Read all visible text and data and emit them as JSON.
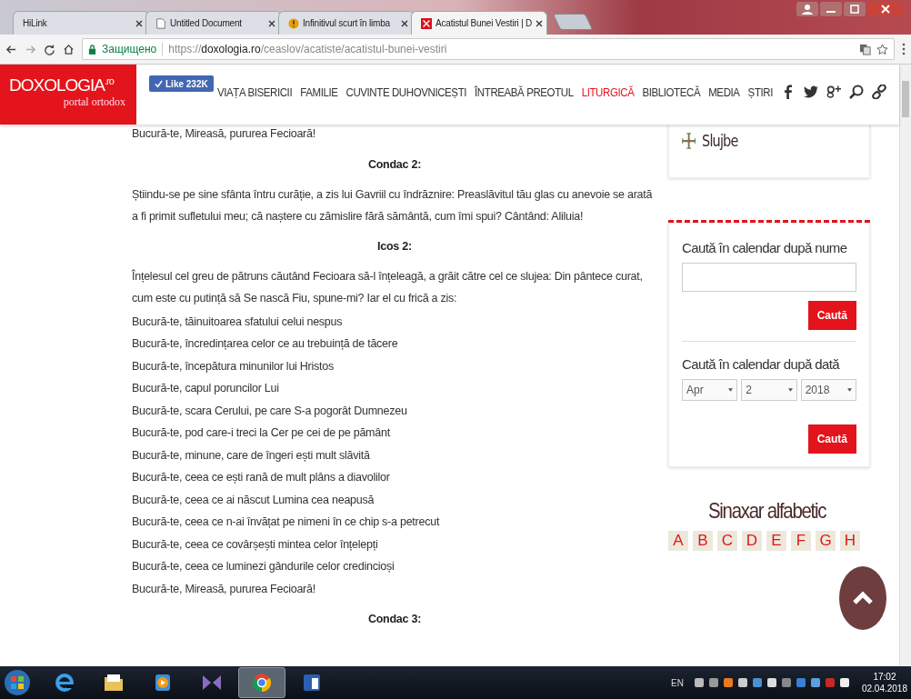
{
  "browser": {
    "tabs": [
      {
        "title": "HiLink",
        "selected": false
      },
      {
        "title": "Untitled Document",
        "selected": false
      },
      {
        "title": "Infinitivul scurt în limba",
        "selected": false
      },
      {
        "title": "Acatistul Bunei Vestiri | D",
        "selected": true
      }
    ],
    "security_label": "Защищено",
    "url": "https://**doxologia.ro**/ceaslov/acatiste/acatistul-bunei-vestiri"
  },
  "site": {
    "logo": "DOXOLOGIA$^{.ro}$",
    "tagline": "portal ortodox",
    "like_button": "Like 232K",
    "nav": [
      {
        "label": "VIAȚA BISERICII",
        "selected": false
      },
      {
        "label": "FAMILIE",
        "selected": false
      },
      {
        "label": "CUVINTE DUHOVNICEȘTI",
        "selected": false
      },
      {
        "label": "ÎNTREABĂ PREOTUL",
        "selected": false
      },
      {
        "label": "LITURGICĂ",
        "selected": true
      },
      {
        "label": "BIBLIOTECĂ",
        "selected": false
      },
      {
        "label": "MEDIA",
        "selected": false
      },
      {
        "label": "ȘTIRI",
        "selected": false
      }
    ]
  },
  "article": [
    {
      "kind": "line",
      "text": "Bucură-te, Mireasă, pururea Fecioară!"
    },
    {
      "kind": "heading",
      "text": "Condac 2:"
    },
    {
      "kind": "paragraph",
      "text": "Știindu-se pe sine sfânta întru curăție, a zis lui Gavriil cu îndrăznire: Preaslăvitul tău glas cu anevoie se arată a fi primit sufletului meu; că naștere cu zămislire fără sământă, cum îmi spui? Cântând: Aliluia!"
    },
    {
      "kind": "heading",
      "text": "Icos 2:"
    },
    {
      "kind": "paragraph",
      "text": "Înțelesul cel greu de pătruns căutând Fecioara să-l înțeleagă, a grăit către cel ce slujea: Din pântece curat, cum este cu putință să Se nască Fiu, spune-mi? Iar el cu frică a zis:"
    },
    {
      "kind": "line",
      "text": "Bucură-te, tăinuitoarea sfatului celui nespus"
    },
    {
      "kind": "line",
      "text": "Bucură-te, încredințarea celor ce au trebuință de tăcere"
    },
    {
      "kind": "line",
      "text": "Bucură-te, începătura minunilor lui Hristos"
    },
    {
      "kind": "line",
      "text": "Bucură-te, capul poruncilor Lui"
    },
    {
      "kind": "line",
      "text": "Bucură-te, scara Cerului, pe care S-a pogorât Dumnezeu"
    },
    {
      "kind": "line",
      "text": "Bucură-te, pod care-i treci la Cer pe cei de pe pământ"
    },
    {
      "kind": "line",
      "text": "Bucură-te, minune, care de îngeri ești mult slăvită"
    },
    {
      "kind": "line",
      "text": "Bucură-te, ceea ce ești rană de mult plâns a diavolilor"
    },
    {
      "kind": "line",
      "text": "Bucură-te, ceea ce ai născut Lumina cea neapusă"
    },
    {
      "kind": "line",
      "text": "Bucură-te, ceea ce n-ai învățat pe nimeni în ce chip s-a petrecut"
    },
    {
      "kind": "line",
      "text": "Bucură-te, ceea ce covârșești mintea celor înțelepți"
    },
    {
      "kind": "line",
      "text": "Bucură-te, ceea ce luminezi gândurile celor credincioși"
    },
    {
      "kind": "line",
      "text": "Bucură-te, Mireasă, pururea Fecioară!"
    },
    {
      "kind": "heading",
      "text": "Condac 3:"
    }
  ],
  "sidebar": {
    "services_link": "Slujbe",
    "name_search": {
      "heading": "Caută în calendar după nume",
      "button": "Caută"
    },
    "date_search": {
      "heading": "Caută în calendar după dată",
      "selects": [
        "Apr",
        "2",
        "2018"
      ],
      "button": "Caută"
    },
    "synaxarion": {
      "title": "Sinaxar alfabetic",
      "letters": [
        "A",
        "B",
        "C",
        "D",
        "E",
        "F",
        "G",
        "H"
      ]
    }
  },
  "taskbar": {
    "apps": [
      {
        "kind": "ie",
        "selected": false
      },
      {
        "kind": "folder",
        "selected": false
      },
      {
        "kind": "media",
        "selected": false
      },
      {
        "kind": "studio",
        "selected": false
      },
      {
        "kind": "chrome",
        "selected": true
      },
      {
        "kind": "word",
        "selected": false
      }
    ],
    "language": "EN",
    "time": "17:02",
    "date": "02.04.2018"
  }
}
